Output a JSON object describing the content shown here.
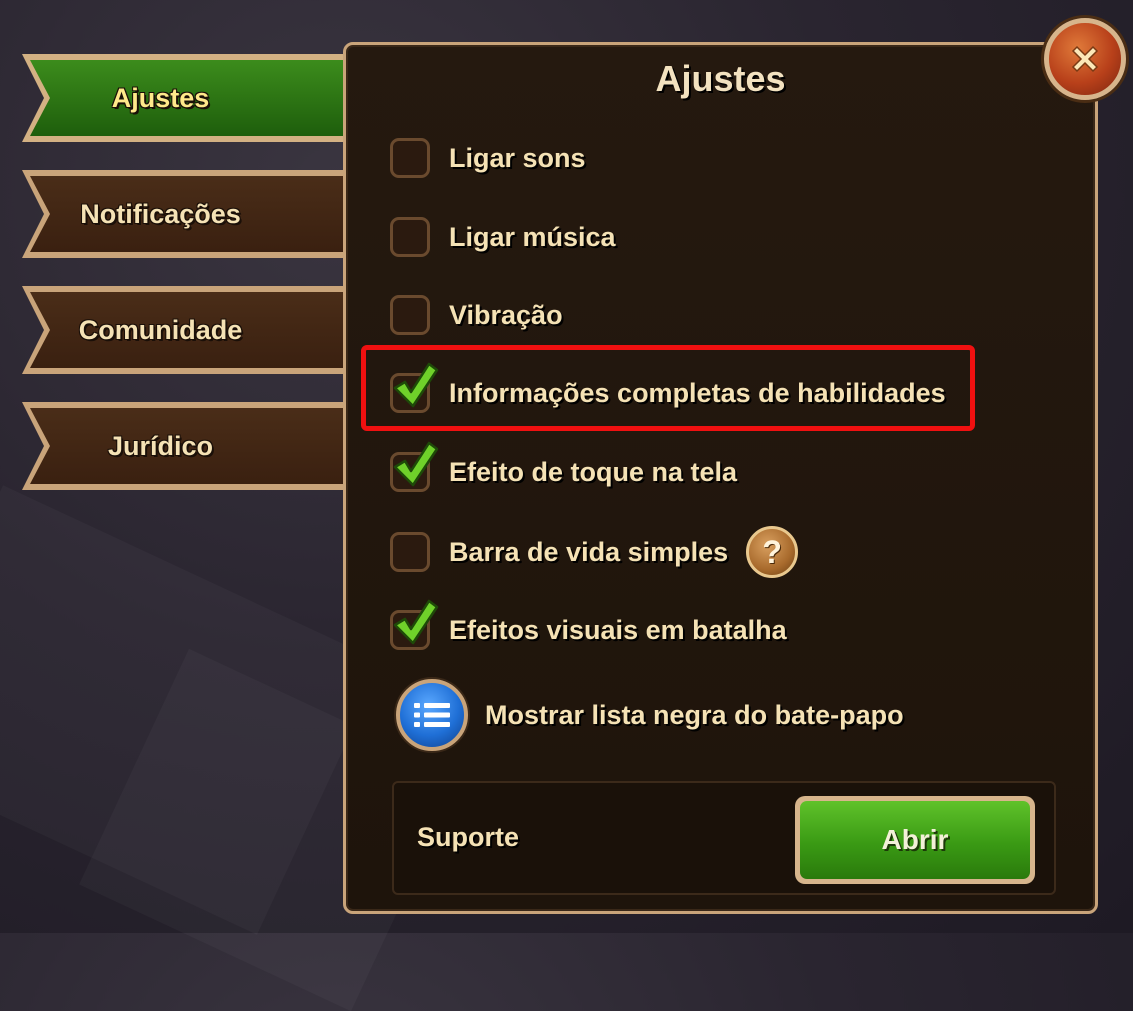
{
  "tabs": [
    {
      "label": "Ajustes",
      "active": true
    },
    {
      "label": "Notificações",
      "active": false
    },
    {
      "label": "Comunidade",
      "active": false
    },
    {
      "label": "Jurídico",
      "active": false
    }
  ],
  "panel": {
    "title": "Ajustes"
  },
  "options": [
    {
      "label": "Ligar sons",
      "checked": false
    },
    {
      "label": "Ligar música",
      "checked": false
    },
    {
      "label": "Vibração",
      "checked": false
    },
    {
      "label": "Informações completas de habilidades",
      "checked": true
    },
    {
      "label": "Efeito de toque na tela",
      "checked": true
    },
    {
      "label": "Barra de vida simples",
      "checked": false
    },
    {
      "label": "Efeitos visuais em batalha",
      "checked": true
    }
  ],
  "blacklist": {
    "label": "Mostrar lista negra do bate-papo",
    "icon": "list-icon"
  },
  "help": {
    "glyph": "?",
    "icon": "question-icon"
  },
  "support": {
    "label": "Suporte",
    "button_label": "Abrir"
  },
  "close": {
    "icon": "close-icon"
  },
  "colors": {
    "accent_green": "#3a9a14",
    "highlight": "#f01010",
    "text": "#f5e2b5",
    "frame": "#c9a47a"
  }
}
